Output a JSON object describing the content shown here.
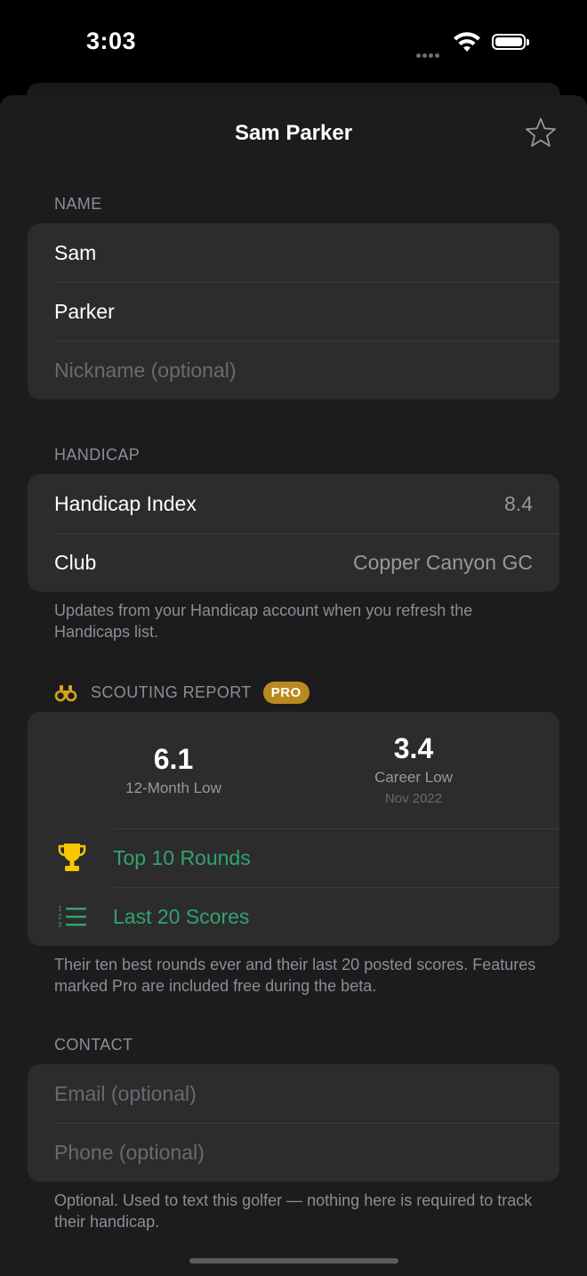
{
  "status": {
    "time": "3:03"
  },
  "title": "Sam Parker",
  "name_section": {
    "header": "NAME",
    "first_name": "Sam",
    "last_name": "Parker",
    "nickname_placeholder": "Nickname (optional)"
  },
  "handicap_section": {
    "header": "HANDICAP",
    "index_label": "Handicap Index",
    "index_value": "8.4",
    "club_label": "Club",
    "club_value": "Copper Canyon GC",
    "footer": "Updates from your Handicap account when you refresh the Handicaps list."
  },
  "scouting": {
    "header": "SCOUTING REPORT",
    "badge": "PRO",
    "low12_value": "6.1",
    "low12_label": "12-Month Low",
    "career_value": "3.4",
    "career_label": "Career Low",
    "career_date": "Nov 2022",
    "top_rounds": "Top 10 Rounds",
    "last_scores": "Last 20 Scores",
    "footer": "Their ten best rounds ever and their last 20 posted scores. Features marked Pro are included free during the beta."
  },
  "contact": {
    "header": "CONTACT",
    "email_placeholder": "Email (optional)",
    "phone_placeholder": "Phone (optional)",
    "footer": "Optional. Used to text this golfer — nothing here is required to track their handicap."
  },
  "colors": {
    "accent_green": "#30a46c",
    "pro_gold": "#b88a1f",
    "trophy_yellow": "#f7c600"
  },
  "icons": [
    "star-icon",
    "binoculars-icon",
    "trophy-icon",
    "numbered-list-icon",
    "wifi-icon",
    "battery-icon"
  ]
}
